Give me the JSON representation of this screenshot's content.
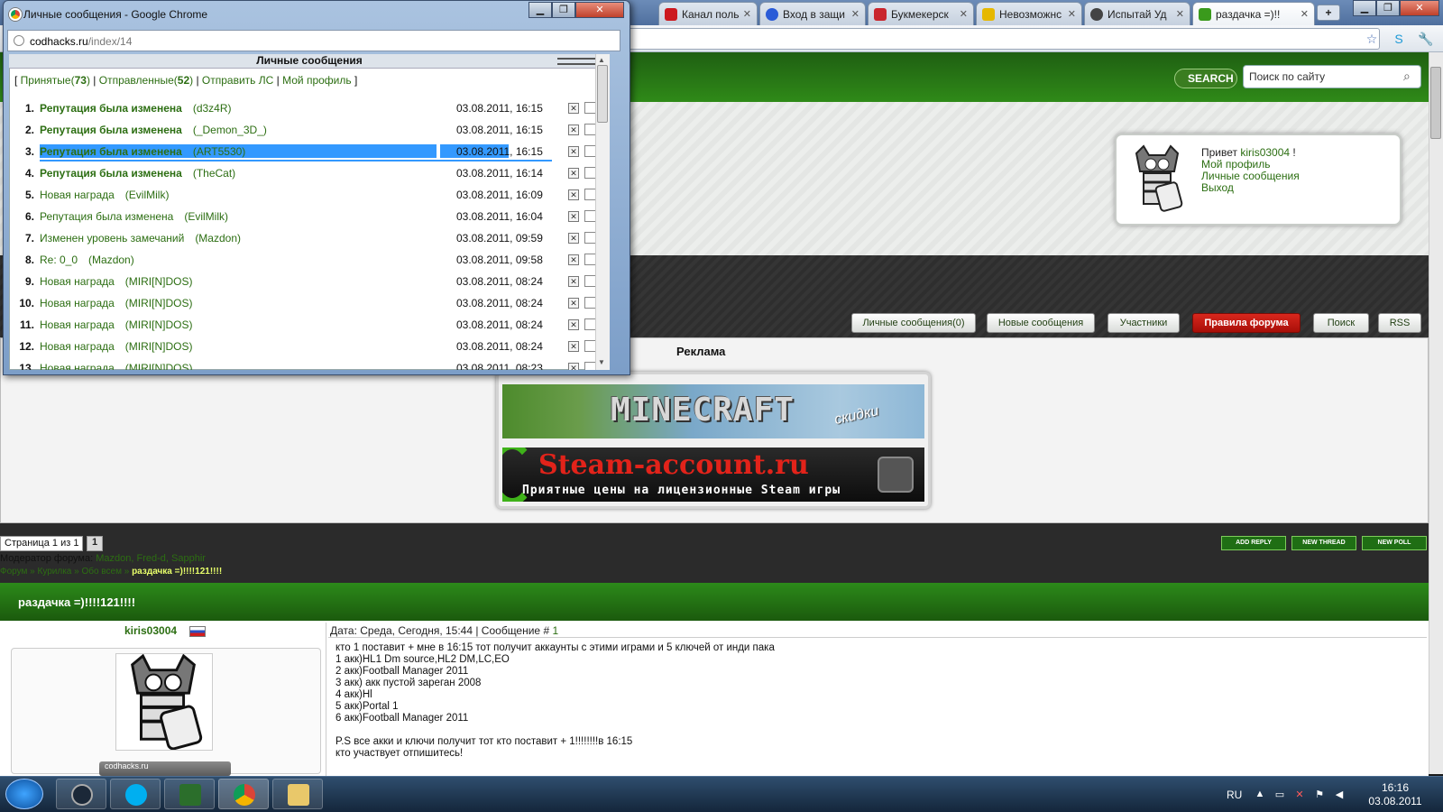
{
  "main_tabs": [
    {
      "label": "Канал польз",
      "color": "#cc181e"
    },
    {
      "label": "Вход в защи",
      "color": "#2a5bd7"
    },
    {
      "label": "Букмекерск",
      "color": "#c9252c"
    },
    {
      "label": "Невозможнс",
      "color": "#e6b800"
    },
    {
      "label": "Испытай Уд",
      "color": "#444444"
    },
    {
      "label": "раздачка =)!!",
      "color": "#3a9a1c"
    }
  ],
  "popup": {
    "title": "Личные сообщения - Google Chrome",
    "url_host": "codhacks.ru",
    "url_path": "/index/14",
    "header": "Личные сообщения",
    "nav": {
      "inbox_label": "Принятые",
      "inbox_count": "73",
      "sent_label": "Отправленные",
      "sent_count": "52",
      "send_label": "Отправить ЛС",
      "profile_label": "Мой профиль"
    },
    "messages": [
      {
        "num": "1.",
        "subject": "Репутация была изменена",
        "from": "(d3z4R)",
        "date": "03.08.2011, 16:15",
        "unread": true
      },
      {
        "num": "2.",
        "subject": "Репутация была изменена",
        "from": "(_Demon_3D_)",
        "date": "03.08.2011, 16:15",
        "unread": true
      },
      {
        "num": "3.",
        "subject": "Репутация была изменена",
        "from": "(ART5530)",
        "date": "03.08.2011, 16:15",
        "unread": true
      },
      {
        "num": "4.",
        "subject": "Репутация была изменена",
        "from": "(TheCat)",
        "date": "03.08.2011, 16:14",
        "unread": true
      },
      {
        "num": "5.",
        "subject": "Новая награда",
        "from": "(EvilMilk)",
        "date": "03.08.2011, 16:09",
        "unread": false
      },
      {
        "num": "6.",
        "subject": "Репутация была изменена",
        "from": "(EvilMilk)",
        "date": "03.08.2011, 16:04",
        "unread": false
      },
      {
        "num": "7.",
        "subject": "Изменен уровень замечаний",
        "from": "(Mazdon)",
        "date": "03.08.2011, 09:59",
        "unread": false
      },
      {
        "num": "8.",
        "subject": "Re: 0_0",
        "from": "(Mazdon)",
        "date": "03.08.2011, 09:58",
        "unread": false
      },
      {
        "num": "9.",
        "subject": "Новая награда",
        "from": "(MIRI[N]DOS)",
        "date": "03.08.2011, 08:24",
        "unread": false
      },
      {
        "num": "10.",
        "subject": "Новая награда",
        "from": "(MIRI[N]DOS)",
        "date": "03.08.2011, 08:24",
        "unread": false
      },
      {
        "num": "11.",
        "subject": "Новая награда",
        "from": "(MIRI[N]DOS)",
        "date": "03.08.2011, 08:24",
        "unread": false
      },
      {
        "num": "12.",
        "subject": "Новая награда",
        "from": "(MIRI[N]DOS)",
        "date": "03.08.2011, 08:24",
        "unread": false
      },
      {
        "num": "13.",
        "subject": "Новая награда",
        "from": "(MIRI[N]DOS)",
        "date": "03.08.2011, 08:23",
        "unread": false
      }
    ]
  },
  "forum": {
    "search_button": "SEARCH",
    "search_placeholder": "Поиск по сайту",
    "greeting": "Привет",
    "username": "kiris03004",
    "greeting_end": "!",
    "user_links": [
      "Мой профиль",
      "Личные сообщения",
      "Выход"
    ],
    "nav_buttons": [
      "Личные сообщения(0)",
      "Новые сообщения",
      "Участники",
      "Правила форума",
      "Поиск",
      "RSS"
    ],
    "ad_title": "Реклама",
    "ad1_text": "MINECRAFT",
    "ad1_sub": "скидки",
    "ad2_text": "Steam-account.ru",
    "ad2_sub": "Приятные цены на лицензионные Steam игры",
    "pagination": "Страница 1 из 1",
    "page_current": "1",
    "moderator_label": "Модератор форума:",
    "moderators": "Mazdon, Fred-d, Sapphir",
    "breadcrumbs": "Форум » Курилка » Обо всем »",
    "breadcrumb_current": "раздачка =)!!!!121!!!!",
    "action_buttons": [
      "ADD REPLY",
      "NEW THREAD",
      "NEW POLL"
    ],
    "thread_title": "раздачка =)!!!!121!!!!",
    "post_user": "kiris03004",
    "post_meta": "Дата: Среда, Сегодня, 15:44 | Сообщение #",
    "post_number": "1",
    "post_badge": "codhacks.ru",
    "post_lines": [
      "кто 1 поставит + мне в 16:15 тот получит аккаунты с этими играми и 5 ключей от инди пака",
      "1 акк)HL1 Dm source,HL2 DM,LC,EO",
      "2 акк)Football Manager 2011",
      "3 акк) акк пустой зареган 2008",
      "4 акк)Hl",
      "5 акк)Portal 1",
      "6 акк)Football Manager 2011",
      "",
      "P.S все акки и ключи получит тот кто поставит + 1!!!!!!!!в 16:15",
      "кто участвует отпишитесь!"
    ]
  },
  "taskbar": {
    "lang": "RU",
    "time": "16:16",
    "date": "03.08.2011"
  },
  "colors": {
    "forum_green": "#2c6e12",
    "header_green": "#2f8a18",
    "selection_blue": "#3399ff",
    "rules_red": "#d8271d"
  }
}
